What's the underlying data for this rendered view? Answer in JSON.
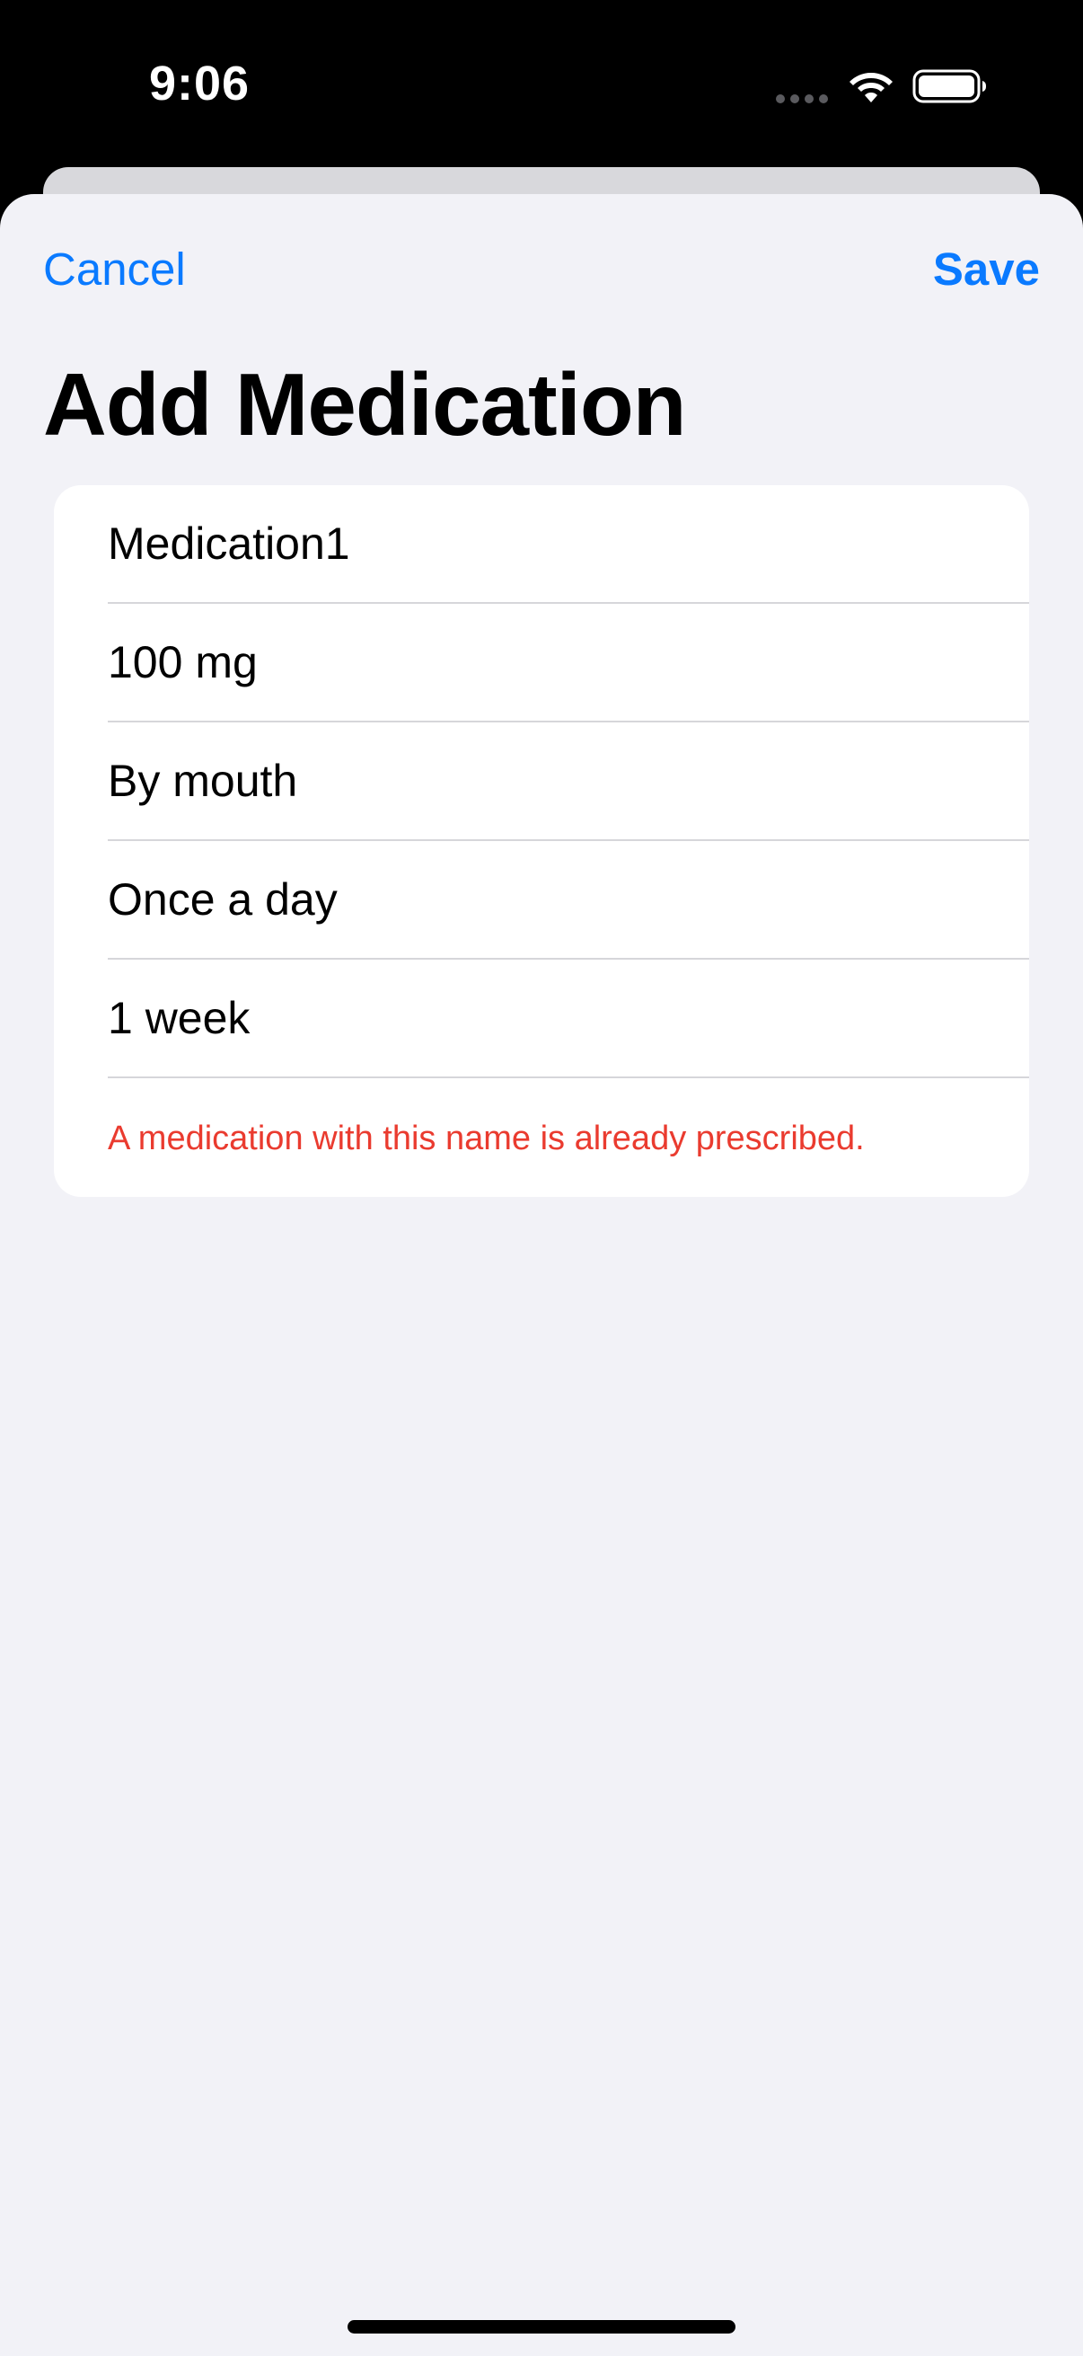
{
  "status_bar": {
    "time": "9:06",
    "icons": [
      "cellular-signal-icon",
      "wifi-icon",
      "battery-icon"
    ]
  },
  "nav": {
    "cancel_label": "Cancel",
    "save_label": "Save"
  },
  "title": "Add Medication",
  "form": {
    "fields": [
      {
        "name": "medication-name",
        "value": "Medication1"
      },
      {
        "name": "dosage",
        "value": "100 mg"
      },
      {
        "name": "route",
        "value": "By mouth"
      },
      {
        "name": "frequency",
        "value": "Once a day"
      },
      {
        "name": "duration",
        "value": "1 week"
      }
    ],
    "error": "A medication with this name is already prescribed."
  },
  "colors": {
    "accent": "#0a7aff",
    "error": "#ea3b2f",
    "background": "#f2f2f7",
    "card": "#ffffff"
  }
}
